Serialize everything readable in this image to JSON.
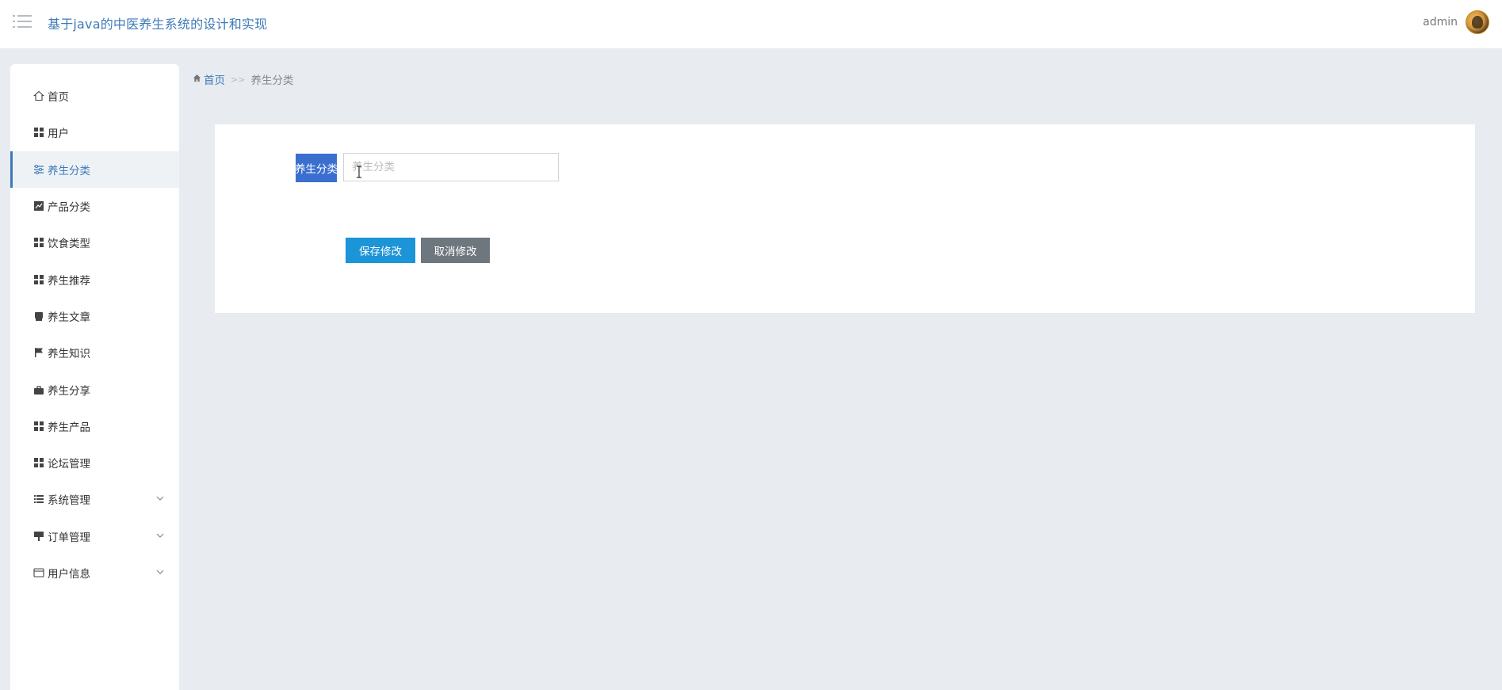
{
  "header": {
    "title": "基于java的中医养生系统的设计和实现",
    "username": "admin",
    "brand_color": "#3d7ab8"
  },
  "sidebar": {
    "items": [
      {
        "label": "首页",
        "icon": "home-icon"
      },
      {
        "label": "用户",
        "icon": "grid-icon"
      },
      {
        "label": "养生分类",
        "icon": "sliders-icon",
        "active": true
      },
      {
        "label": "产品分类",
        "icon": "chart-icon"
      },
      {
        "label": "饮食类型",
        "icon": "grid-icon"
      },
      {
        "label": "养生推荐",
        "icon": "grid-icon"
      },
      {
        "label": "养生文章",
        "icon": "printer-icon"
      },
      {
        "label": "养生知识",
        "icon": "flag-icon"
      },
      {
        "label": "养生分享",
        "icon": "briefcase-icon"
      },
      {
        "label": "养生产品",
        "icon": "grid-icon"
      },
      {
        "label": "论坛管理",
        "icon": "grid-icon"
      },
      {
        "label": "系统管理",
        "icon": "list-icon",
        "expandable": true
      },
      {
        "label": "订单管理",
        "icon": "sign-icon",
        "expandable": true
      },
      {
        "label": "用户信息",
        "icon": "card-icon",
        "expandable": true
      }
    ]
  },
  "breadcrumb": {
    "home": "首页",
    "separator": ">>",
    "current": "养生分类"
  },
  "form": {
    "field_label": "养生分类",
    "field_placeholder": "养生分类",
    "field_value": "",
    "save_label": "保存修改",
    "cancel_label": "取消修改"
  },
  "colors": {
    "label_bg": "#3a6fd0",
    "save_bg": "#1b94d8",
    "cancel_bg": "#6e767e",
    "page_bg": "#e8ebef"
  }
}
